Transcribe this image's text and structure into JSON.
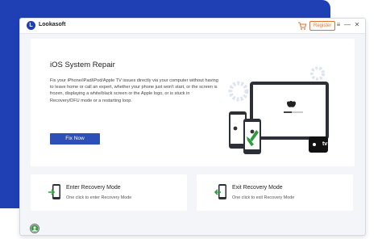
{
  "app": {
    "brand": "Lookasoft",
    "register_label": "Register"
  },
  "titlebar": {
    "menu_glyph": "≡",
    "minimize_glyph": "—",
    "close_glyph": "✕"
  },
  "main": {
    "title": "iOS System Repair",
    "description": "Fix your iPhone/iPad/iPod/Apple TV issues directly via your computer without having to leave home or call an expert, whether your phone just won't start, or the screen is frozen, displaying a white/black screen or the Apple logo, or is stuck in Recovery/DFU mode or a restarting loop.",
    "fix_button": "Fix Now",
    "appletv_label": "tv"
  },
  "cards": {
    "enter": {
      "title": "Enter Recovery Mode",
      "subtitle": "One click to enter Recovery Mode"
    },
    "exit": {
      "title": "Exit Recovery Mode",
      "subtitle": "One click to exit Recovery Mode"
    }
  },
  "colors": {
    "accent": "#2c4fb8",
    "brand_blue": "#1f3fb5",
    "register_orange": "#e0712e",
    "icon_green": "#2e9b3e"
  },
  "icons": [
    "logo-icon",
    "cart-icon",
    "menu-icon",
    "minimize-icon",
    "close-icon",
    "enter-recovery-icon",
    "exit-recovery-icon",
    "user-avatar-icon"
  ]
}
